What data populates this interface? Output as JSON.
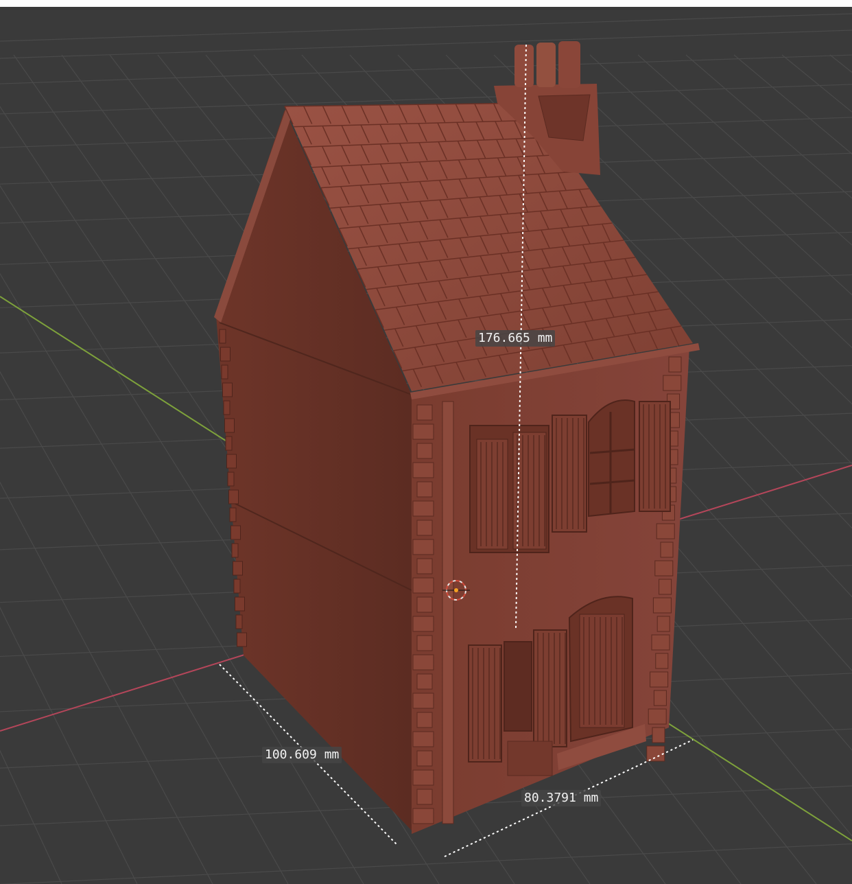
{
  "viewport": {
    "background_color": "#3a3a3a",
    "grid_color": "#4a4a4a",
    "x_axis_color": "#c0485a",
    "y_axis_color": "#7fa43c",
    "model_color": "#7a3b2e"
  },
  "measurements": {
    "height_label": "176.665 mm",
    "depth_label": "100.609 mm",
    "width_label": "80.3791 mm"
  }
}
